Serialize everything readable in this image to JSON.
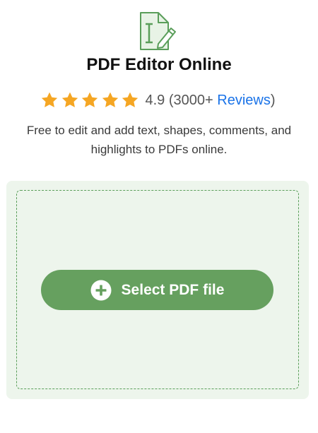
{
  "header": {
    "icon": "pdf-edit-icon",
    "title": "PDF Editor Online"
  },
  "rating": {
    "stars": 5,
    "score": "4.9",
    "open_paren": "(",
    "count": "3000+ ",
    "reviews_link": "Reviews",
    "close_paren": ")"
  },
  "description": "Free to edit and add text, shapes, comments, and highlights to PDFs online.",
  "dropzone": {
    "button_label": "Select PDF file",
    "button_icon": "plus-circle-icon"
  },
  "colors": {
    "accent_green": "#66a05f",
    "dropzone_bg": "#edf5ec",
    "star": "#f5a623",
    "link": "#1a73e8"
  }
}
